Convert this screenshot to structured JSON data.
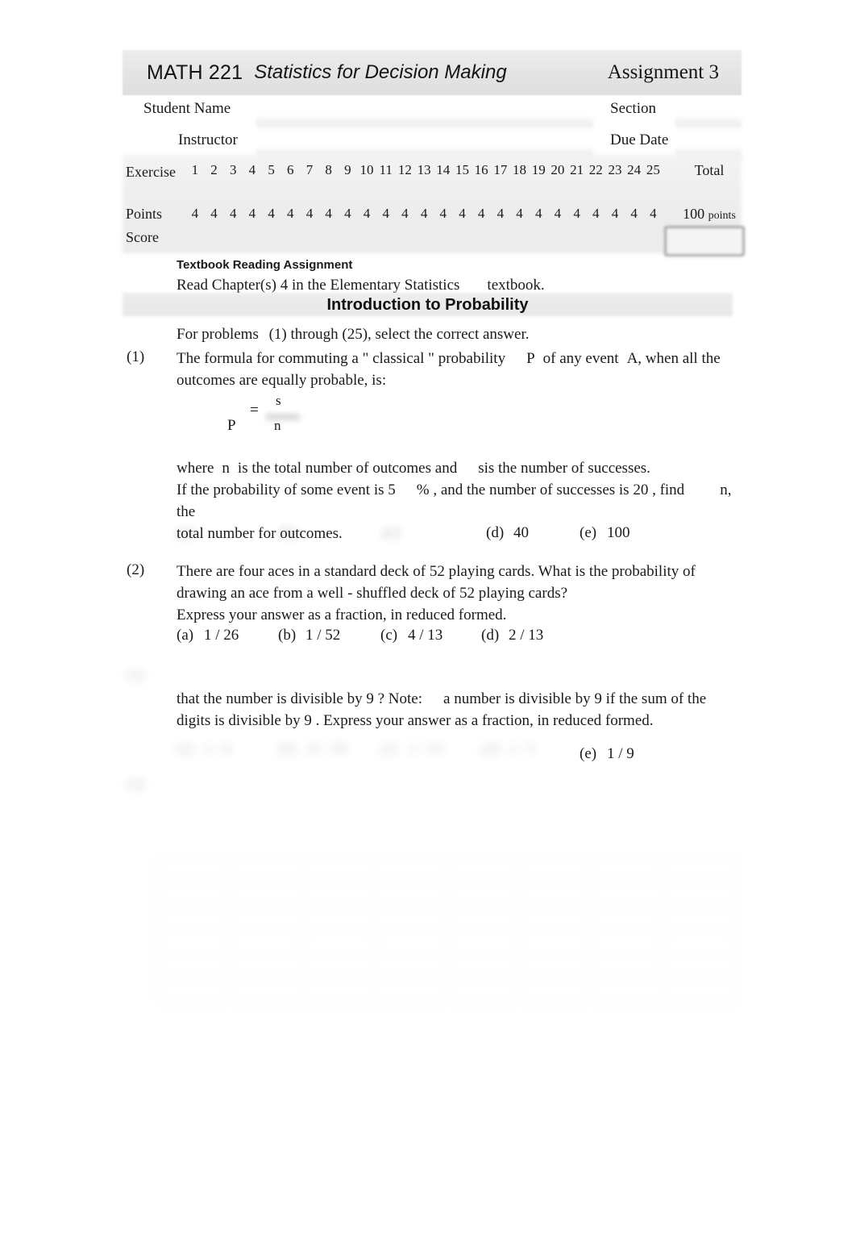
{
  "document": {
    "header": {
      "course_code": "MATH 221",
      "course_title": "Statistics for Decision Making",
      "assignment": "Assignment 3"
    },
    "fields": {
      "student_name_label": "Student Name",
      "section_label": "Section",
      "instructor_label": "Instructor",
      "due_date_label": "Due Date",
      "student_name_value": "",
      "section_value": "",
      "instructor_value": "",
      "due_date_value": ""
    },
    "grade_table": {
      "row_labels": [
        "Exercise",
        "Points",
        "Score"
      ],
      "exercise_numbers": [
        "1",
        "2",
        "3",
        "4",
        "5",
        "6",
        "7",
        "8",
        "9",
        "10",
        "11",
        "12",
        "13",
        "14",
        "15",
        "16",
        "17",
        "18",
        "19",
        "20",
        "21",
        "22",
        "23",
        "24",
        "25"
      ],
      "points": [
        "4",
        "4",
        "4",
        "4",
        "4",
        "4",
        "4",
        "4",
        "4",
        "4",
        "4",
        "4",
        "4",
        "4",
        "4",
        "4",
        "4",
        "4",
        "4",
        "4",
        "4",
        "4",
        "4",
        "4",
        "4"
      ],
      "scores": [
        "",
        "",
        "",
        "",
        "",
        "",
        "",
        "",
        "",
        "",
        "",
        "",
        "",
        "",
        "",
        "",
        "",
        "",
        "",
        "",
        "",
        "",
        "",
        "",
        ""
      ],
      "total_header": "Total",
      "total_points": "100",
      "total_points_unit": "points",
      "total_score_value": ""
    },
    "reading": {
      "heading": "Textbook Reading Assignment",
      "text_before": "Read Chapter(s) 4 in the Elementary Statistics",
      "text_after": "textbook."
    },
    "section_banner": "Introduction to Probability",
    "instructions": {
      "lead": "For problems",
      "first": "(1)",
      "through": "through",
      "last": "(25)",
      "tail": ", select the correct answer."
    },
    "questions": [
      {
        "number": "(1)",
        "lines": [
          "The formula for commuting a \" classical \" probability",
          "P",
          "of any event",
          "A",
          ", when all the outcomes are equally probable, is:"
        ],
        "line1": "The formula for commuting a \" classical \" probability",
        "line1b": "P",
        "line1c": "of any event",
        "line1d": "A",
        "line1e": ", when all the",
        "line2": "outcomes are equally probable, is:",
        "formula": {
          "variable": "P",
          "equals": "=",
          "numerator": "s",
          "denominator": "n"
        },
        "where_line1a": "where",
        "where_line1b": "n",
        "where_line1c": "is the total number of outcomes and",
        "where_line1d": "s",
        "where_line1e": "is the number of successes.",
        "where_line2a": "If the probability of some event is 5",
        "where_line2b": "% , and the number of successes is 20 , find",
        "where_line2c": "n",
        "where_line2d": ", the",
        "where_line3": "total number for outcomes.",
        "answers": [
          {
            "key": "(a)",
            "value": "",
            "redacted": true
          },
          {
            "key": "(b)",
            "value": "",
            "redacted": true
          },
          {
            "key": "(c)",
            "value": "",
            "redacted": true
          },
          {
            "key": "(d)",
            "value": "40",
            "redacted": false
          },
          {
            "key": "(e)",
            "value": "100",
            "redacted": false
          }
        ]
      },
      {
        "number": "(2)",
        "line1": "There are four aces in a standard deck of 52 playing cards.  What is the probability of",
        "line2": "drawing an ace from a well - shuffled deck of 52 playing cards?",
        "line3": "Express your answer as a fraction, in reduced formed.",
        "answers": [
          {
            "key": "(a)",
            "value": "1 / 26",
            "redacted": false
          },
          {
            "key": "(b)",
            "value": "1 / 52",
            "redacted": false
          },
          {
            "key": "(c)",
            "value": "4 / 13",
            "redacted": false
          },
          {
            "key": "(d)",
            "value": "2 / 13",
            "redacted": false
          }
        ]
      },
      {
        "number": "(3)",
        "line1": "",
        "line2a": "that the number is divisible by 9 ?  Note:",
        "line2b": "a number is divisible by 9 if the sum of the",
        "line3": "digits is divisible by 9 .  Express your answer as a fraction, in reduced formed.",
        "answers": [
          {
            "key": "(a)",
            "value": "1 / 4",
            "redacted": true
          },
          {
            "key": "(b)",
            "value": "11 / 50",
            "redacted": true
          },
          {
            "key": "(c)",
            "value": "1 / 10",
            "redacted": true
          },
          {
            "key": "(d)",
            "value": "1 / 5",
            "redacted": true
          },
          {
            "key": "(e)",
            "value": "1 / 9",
            "redacted": false
          }
        ]
      },
      {
        "number": "(4)",
        "line1": "",
        "line2": "",
        "line3": "",
        "redacted": true
      }
    ],
    "data_table": {
      "redacted": true,
      "column_headers": [
        "",
        "",
        "",
        "",
        "",
        "",
        "",
        ""
      ],
      "row_labels": [
        "",
        "",
        "",
        "",
        "",
        ""
      ],
      "rows": [
        [
          "",
          "",
          "",
          "",
          "",
          "",
          "",
          ""
        ],
        [
          "",
          "",
          "",
          "",
          "",
          "",
          "",
          ""
        ],
        [
          "",
          "",
          "",
          "",
          "",
          "",
          "",
          ""
        ],
        [
          "",
          "",
          "",
          "",
          "",
          "",
          "",
          ""
        ],
        [
          "",
          "",
          "",
          "",
          "",
          "",
          "",
          ""
        ],
        [
          "",
          "",
          "",
          "",
          "",
          "",
          "",
          ""
        ]
      ]
    },
    "footer": {
      "left": "",
      "right": ""
    }
  }
}
